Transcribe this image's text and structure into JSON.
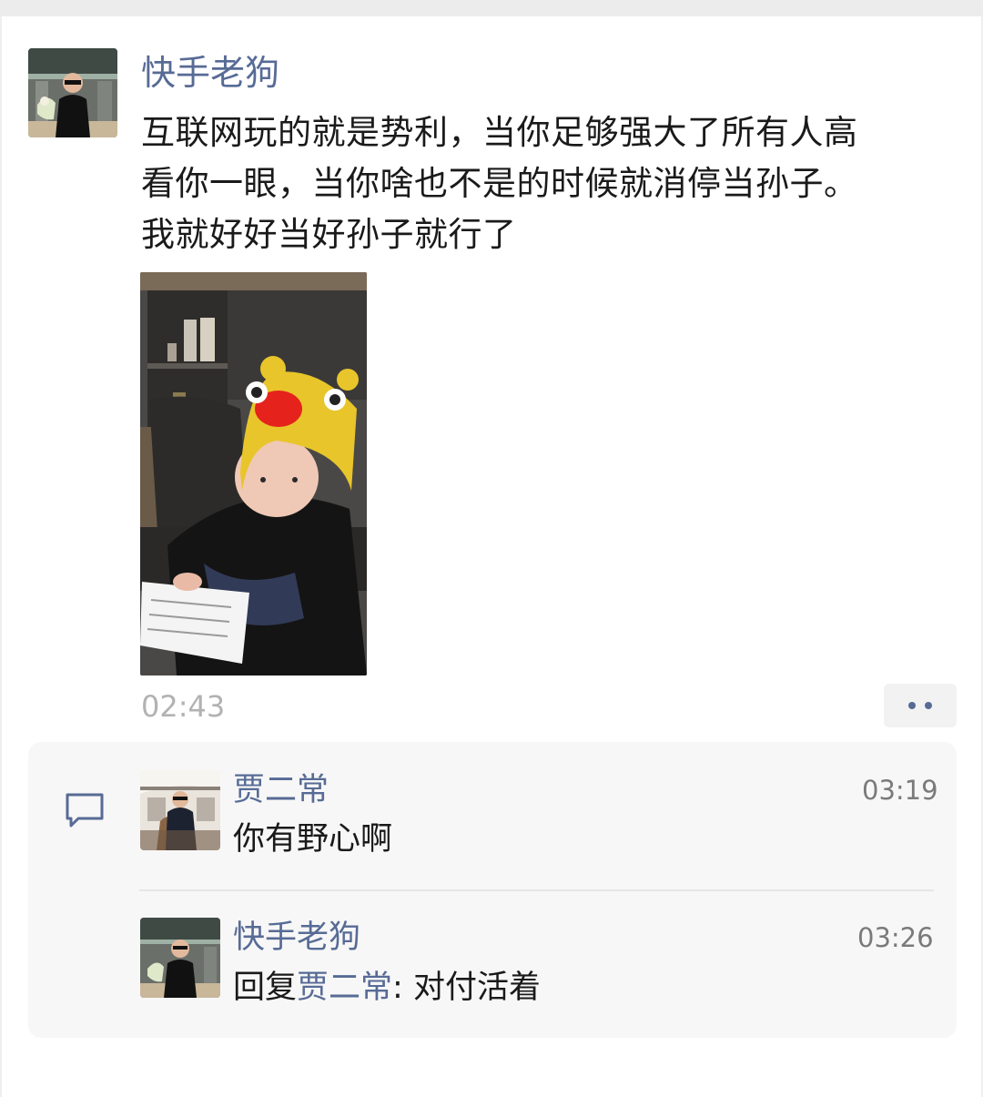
{
  "post": {
    "author": "快手老狗",
    "text_lines": [
      "互联网玩的就是势利，当你足够强大了所有人高",
      "看你一眼，当你啥也不是的时候就消停当孙子。",
      "我就好好当好孙子就行了"
    ],
    "time": "02:43",
    "more_icon": "more-dots-icon"
  },
  "comments": [
    {
      "author": "贾二常",
      "text": "你有野心啊",
      "time": "03:19"
    },
    {
      "author": "快手老狗",
      "reply_prefix": "回复",
      "reply_to": "贾二常",
      "separator": ": ",
      "text": "对付活着",
      "time": "03:26"
    }
  ],
  "colors": {
    "name_link": "#576b95",
    "body_text": "#1a1a1a",
    "time_text": "#b2b2b2",
    "panel_bg": "#f7f7f7"
  },
  "icons": {
    "comment": "comment-bubble-icon"
  }
}
